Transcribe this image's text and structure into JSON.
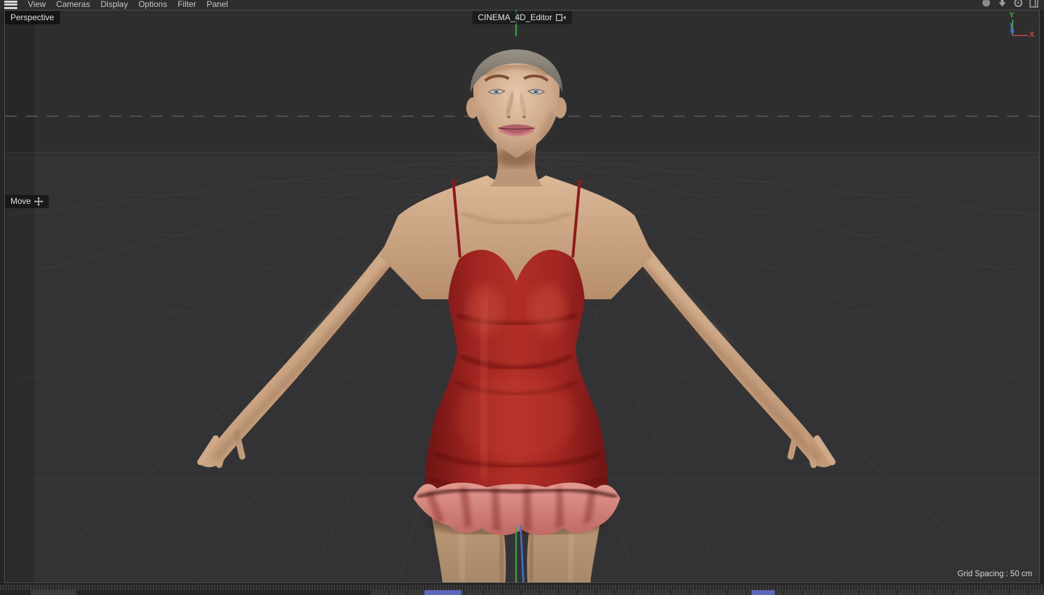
{
  "menu_bar": {
    "menu_icon": "hamburger-icon",
    "items": [
      "View",
      "Cameras",
      "Display",
      "Options",
      "Filter",
      "Panel"
    ],
    "view_control_icons": [
      "pan-camera-icon",
      "zoom-camera-icon",
      "rotate-camera-icon",
      "toggle-view-icon"
    ]
  },
  "viewport": {
    "camera_label": "Perspective",
    "editor_title": "CINEMA_4D_Editor",
    "editor_icon": "camera-icon",
    "tool": {
      "label": "Move",
      "icon": "move-cross-icon"
    },
    "status": {
      "grid_spacing": "Grid Spacing : 50 cm"
    },
    "axis_gizmo": {
      "y_label": "Y",
      "x_label": "X"
    },
    "colors": {
      "background": "#2e2e2f",
      "floor": "#333335",
      "grid_line": "#3b3b3c",
      "axis_x": "#cc4743",
      "axis_y": "#3dae47",
      "axis_z": "#4a6ed0"
    }
  },
  "scene": {
    "colors": {
      "dress_red": "#a2241f",
      "ruffle_pink": "#d5837c",
      "skin": "#c9a483",
      "hair": "#8b857b"
    }
  },
  "timeline": {
    "accent_color": "#5f67ba"
  }
}
